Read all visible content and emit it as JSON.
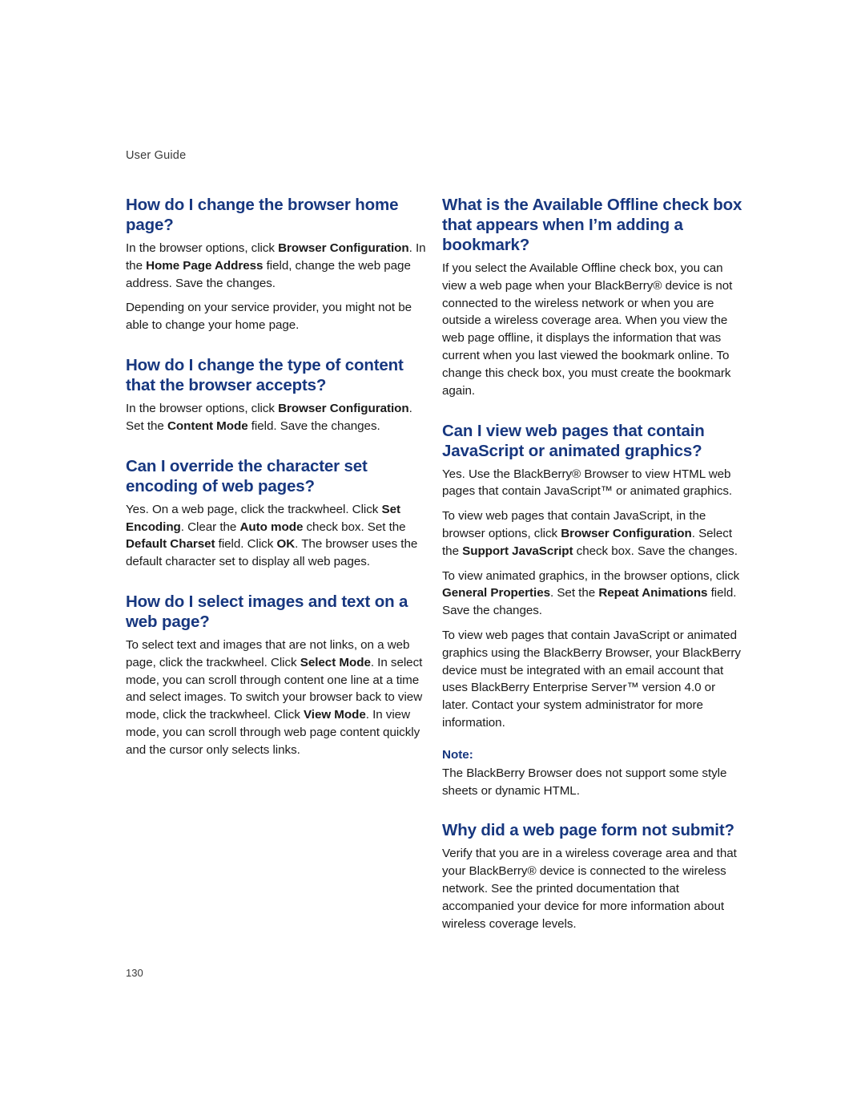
{
  "document": {
    "running_head": "User Guide",
    "page_number": "130",
    "heading_color": "#17377f",
    "body_color": "#1a1a1a"
  },
  "left_column": {
    "sections": [
      {
        "heading": "How do I change the browser home page?",
        "paragraphs": [
          {
            "runs": [
              {
                "t": "In the browser options, click ",
                "b": false
              },
              {
                "t": "Browser Configuration",
                "b": true
              },
              {
                "t": ". In the ",
                "b": false
              },
              {
                "t": "Home Page Address",
                "b": true
              },
              {
                "t": " field, change the web page address. Save the changes.",
                "b": false
              }
            ]
          },
          {
            "runs": [
              {
                "t": "Depending on your service provider, you might not be able to change your home page.",
                "b": false
              }
            ]
          }
        ]
      },
      {
        "heading": "How do I change the type of content that the browser accepts?",
        "paragraphs": [
          {
            "runs": [
              {
                "t": "In the browser options, click ",
                "b": false
              },
              {
                "t": "Browser Configuration",
                "b": true
              },
              {
                "t": ". Set the ",
                "b": false
              },
              {
                "t": "Content Mode",
                "b": true
              },
              {
                "t": " field. Save the changes.",
                "b": false
              }
            ]
          }
        ]
      },
      {
        "heading": "Can I override the character set encoding of web pages?",
        "paragraphs": [
          {
            "runs": [
              {
                "t": "Yes. On a web page, click the trackwheel. Click ",
                "b": false
              },
              {
                "t": "Set Encoding",
                "b": true
              },
              {
                "t": ". Clear the ",
                "b": false
              },
              {
                "t": "Auto mode",
                "b": true
              },
              {
                "t": " check box. Set the ",
                "b": false
              },
              {
                "t": "Default Charset",
                "b": true
              },
              {
                "t": " field. Click ",
                "b": false
              },
              {
                "t": "OK",
                "b": true
              },
              {
                "t": ". The browser uses the default character set to display all web pages.",
                "b": false
              }
            ]
          }
        ]
      },
      {
        "heading": "How do I select images and text on a web page?",
        "paragraphs": [
          {
            "runs": [
              {
                "t": "To select text and images that are not links, on a web page, click the trackwheel. Click ",
                "b": false
              },
              {
                "t": "Select Mode",
                "b": true
              },
              {
                "t": ". In select mode, you can scroll through content one line at a time and select images. To switch your browser back to view mode, click the trackwheel. Click ",
                "b": false
              },
              {
                "t": "View Mode",
                "b": true
              },
              {
                "t": ". In view mode, you can scroll through web page content quickly and the cursor only selects links.",
                "b": false
              }
            ]
          }
        ]
      }
    ]
  },
  "right_column": {
    "sections": [
      {
        "heading": "What is the Available Offline check box that appears when I’m adding a bookmark?",
        "paragraphs": [
          {
            "runs": [
              {
                "t": "If you select the Available Offline check box, you can view a web page when your BlackBerry® device is not connected to the wireless network or when you are outside a wireless coverage area. When you view the web page offline, it displays the information that was current when you last viewed the bookmark online. To change this check box, you must create the bookmark again.",
                "b": false
              }
            ]
          }
        ]
      },
      {
        "heading": "Can I view web pages that contain JavaScript or animated graphics?",
        "paragraphs": [
          {
            "runs": [
              {
                "t": "Yes. Use the BlackBerry® Browser to view HTML web pages that contain JavaScript™ or animated graphics.",
                "b": false
              }
            ]
          },
          {
            "runs": [
              {
                "t": "To view web pages that contain JavaScript, in the browser options, click ",
                "b": false
              },
              {
                "t": "Browser Configuration",
                "b": true
              },
              {
                "t": ". Select the ",
                "b": false
              },
              {
                "t": "Support JavaScript",
                "b": true
              },
              {
                "t": " check box. Save the changes.",
                "b": false
              }
            ]
          },
          {
            "runs": [
              {
                "t": "To view animated graphics, in the browser options, click ",
                "b": false
              },
              {
                "t": "General Properties",
                "b": true
              },
              {
                "t": ". Set the ",
                "b": false
              },
              {
                "t": "Repeat Animations",
                "b": true
              },
              {
                "t": " field. Save the changes.",
                "b": false
              }
            ]
          },
          {
            "runs": [
              {
                "t": "To view web pages that contain JavaScript or animated graphics using the BlackBerry Browser, your BlackBerry device must be integrated with an email account that uses BlackBerry Enterprise Server™ version 4.0 or later. Contact your system administrator for more information.",
                "b": false
              }
            ]
          }
        ],
        "note": {
          "label": "Note:",
          "text": "The BlackBerry Browser does not support some style sheets or dynamic HTML."
        }
      },
      {
        "heading": "Why did a web page form not submit?",
        "paragraphs": [
          {
            "runs": [
              {
                "t": "Verify that you are in a wireless coverage area and that your BlackBerry® device is connected to the wireless network. See the printed documentation that accompanied your device for more information about wireless coverage levels.",
                "b": false
              }
            ]
          }
        ]
      }
    ]
  }
}
